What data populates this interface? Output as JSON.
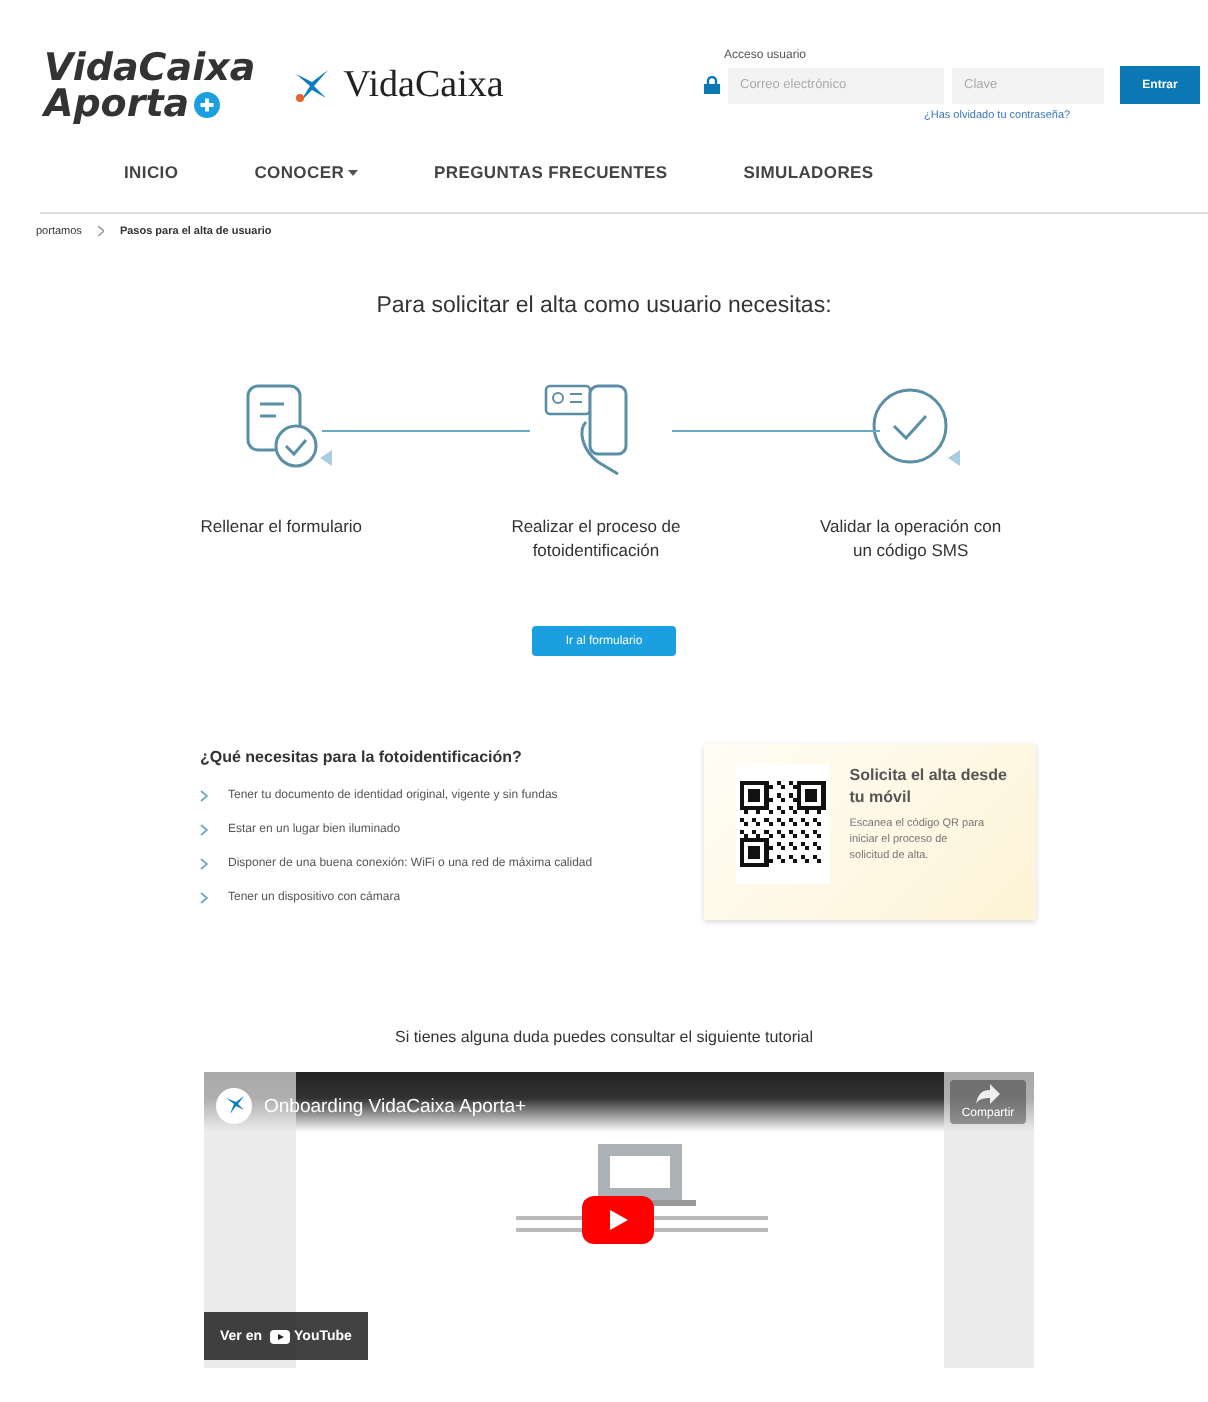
{
  "header": {
    "logo_lines": [
      "VidaCaixa",
      "Aporta"
    ],
    "brand": "VidaCaixa",
    "login_label": "Acceso usuario",
    "email": {
      "placeholder": "Correo electrónico"
    },
    "password": {
      "placeholder": "Clave"
    },
    "submit": "Entrar",
    "forgot": "¿Has olvidado tu contraseña?"
  },
  "nav": [
    {
      "label": "INICIO",
      "has_menu": false
    },
    {
      "label": "CONOCER",
      "has_menu": true
    },
    {
      "label": "PREGUNTAS FRECUENTES",
      "has_menu": false
    },
    {
      "label": "SIMULADORES",
      "has_menu": false
    }
  ],
  "breadcrumb": [
    "portamos",
    "Pasos para el alta de usuario"
  ],
  "heading": "Para solicitar el alta como usuario necesitas:",
  "steps": [
    {
      "kind": "form",
      "label": "Rellenar el formulario"
    },
    {
      "kind": "phone",
      "label": "Realizar el proceso de fotoidentificación"
    },
    {
      "kind": "check",
      "label": "Validar la operación con un código SMS"
    }
  ],
  "cta": "Ir al formulario",
  "requirements": {
    "title": "¿Qué necesitas para la fotoidentificación?",
    "items": [
      "Tener tu documento de identidad original, vigente y sin fundas",
      "Estar en un lugar bien iluminado",
      "Disponer de una buena conexión: WiFi o una red de máxima calidad",
      "Tener un dispositivo con cámara"
    ]
  },
  "mobile_card": {
    "title": "Solicita el alta desde tu móvil",
    "text": "Escanea el código QR para iniciar el proceso de solicitud de alta."
  },
  "tutorial_text": "Si tienes alguna duda puedes consultar el siguiente tutorial",
  "video": {
    "title": "Onboarding VidaCaixa Aporta+",
    "share": "Compartir",
    "watch_on": "Ver en",
    "platform": "YouTube"
  }
}
